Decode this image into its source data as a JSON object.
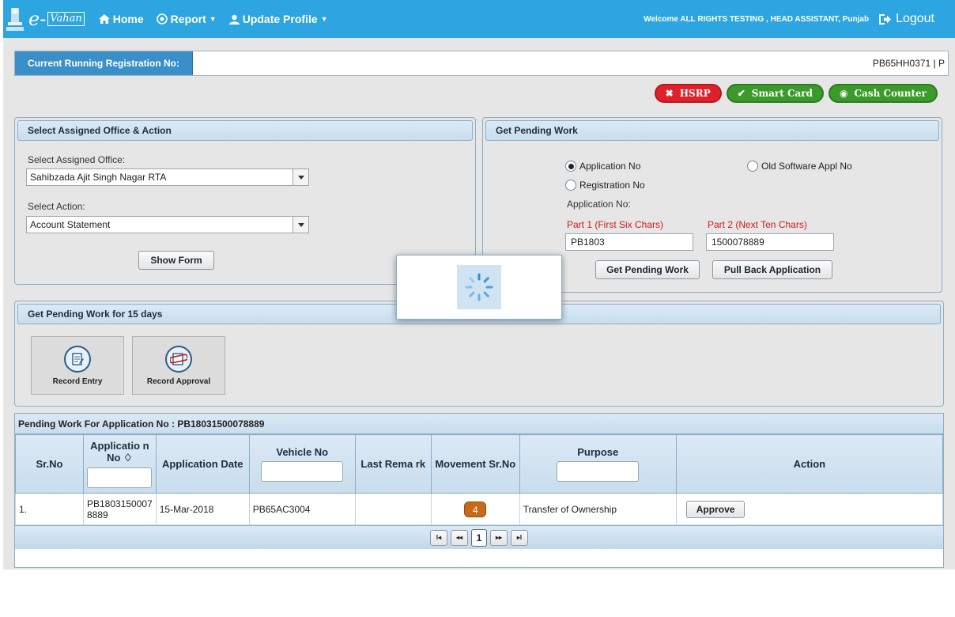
{
  "nav": {
    "brand_prefix": "e-",
    "brand_name": "Vahan",
    "home": "Home",
    "report": "Report",
    "update_profile": "Update Profile",
    "welcome": "Welcome ALL RIGHTS TESTING , HEAD ASSISTANT, Punjab",
    "logout": "Logout"
  },
  "registration": {
    "label": "Current Running Registration No:",
    "value": "PB65HH0371 | P"
  },
  "actions": {
    "hsrp": "HSRP",
    "smart_card": "Smart Card",
    "cash_counter": "Cash Counter"
  },
  "office_panel": {
    "title": "Select Assigned Office & Action",
    "office_label": "Select Assigned Office:",
    "office_value": "Sahibzada Ajit Singh Nagar RTA",
    "action_label": "Select Action:",
    "action_value": "Account Statement",
    "show_form": "Show Form"
  },
  "pending_panel": {
    "title": "Get Pending Work",
    "radio_app_no": "Application No",
    "radio_old_soft": "Old Software Appl No",
    "radio_reg_no": "Registration No",
    "app_no_label": "Application No:",
    "part1_label": "Part 1 (First Six Chars)",
    "part2_label": "Part 2 (Next Ten Chars)",
    "part1_value": "PB1803",
    "part2_value": "1500078889",
    "get_pending": "Get Pending Work",
    "pull_back": "Pull Back Application"
  },
  "days_panel": {
    "title": "Get Pending Work for 15 days",
    "tile1": "Record Entry",
    "tile2": "Record Approval"
  },
  "grid": {
    "title": "Pending Work For Application No : PB18031500078889",
    "headers": {
      "sr": "Sr.No",
      "app_no": "Applicatio n No ♢",
      "app_date": "Application Date",
      "vehicle": "Vehicle No",
      "remark": "Last Rema rk",
      "movement": "Movement Sr.No",
      "purpose": "Purpose",
      "action": "Action"
    },
    "row": {
      "sr": "1.",
      "app_no": "PB1803150007 8889",
      "app_date": "15-Mar-2018",
      "vehicle": "PB65AC3004",
      "remark": "",
      "movement": "4",
      "purpose": "Transfer of Ownership",
      "approve": "Approve"
    },
    "pager": {
      "page": "1"
    }
  }
}
